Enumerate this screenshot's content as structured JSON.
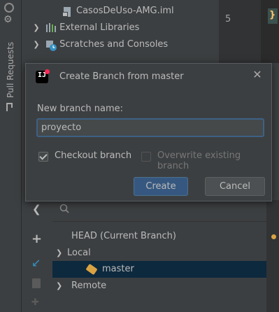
{
  "stripe": {
    "label": "Pull Requests"
  },
  "tree": {
    "file_row": "CasosDeUso-AMG.iml",
    "external_libraries": "External Libraries",
    "scratches": "Scratches and Consoles"
  },
  "editor": {
    "line_number": "5",
    "brace": "}"
  },
  "dialog": {
    "title": "Create Branch from master",
    "field_label": "New branch name:",
    "branch_name_value": "proyecto",
    "checkout_label": "Checkout branch",
    "checkout_checked": true,
    "overwrite_label": "Overwrite existing branch",
    "overwrite_checked": false,
    "create_label": "Create",
    "cancel_label": "Cancel"
  },
  "branches": {
    "head": "HEAD (Current Branch)",
    "local": "Local",
    "master": "master",
    "remote": "Remote"
  },
  "colors": {
    "accent": "#365880",
    "selection": "#0d293e",
    "tag_icon": "#d9a343",
    "background": "#3c3f41"
  }
}
